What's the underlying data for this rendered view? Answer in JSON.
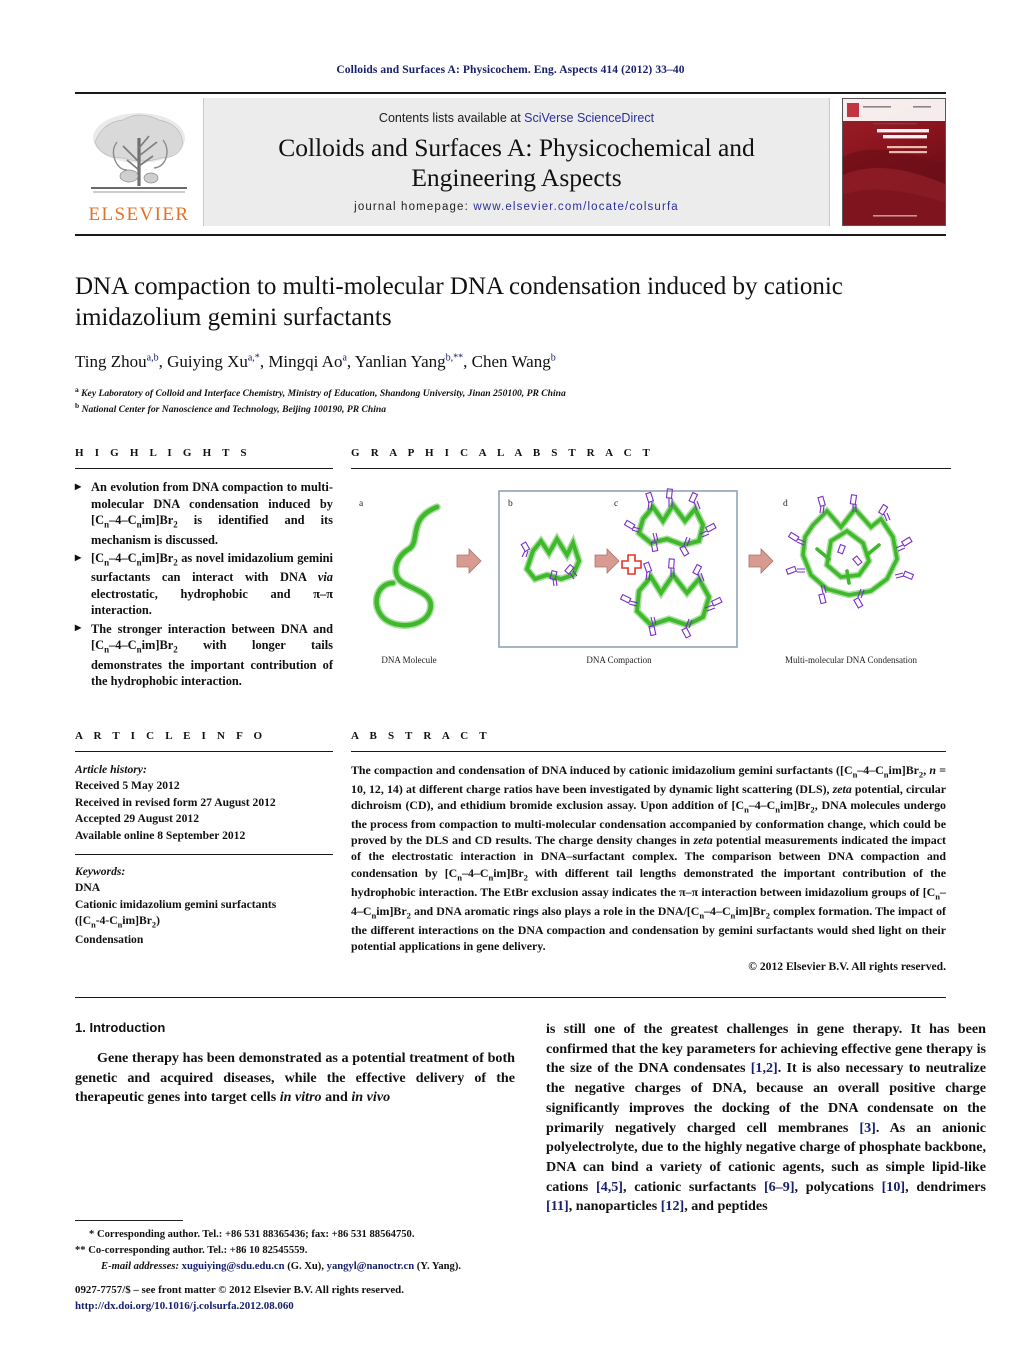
{
  "running_head": "Colloids and Surfaces A: Physicochem. Eng. Aspects 414 (2012) 33–40",
  "masthead": {
    "contents_prefix": "Contents lists available at ",
    "contents_link": "SciVerse ScienceDirect",
    "journal_title_line1": "Colloids and Surfaces A: Physicochemical and",
    "journal_title_line2": "Engineering Aspects",
    "homepage_prefix": "journal homepage:",
    "homepage_url": "www.elsevier.com/locate/colsurfa",
    "publisher": "ELSEVIER",
    "cover_line1": "COLLOIDS AND",
    "cover_line2": "SURFACES A",
    "cover_line3": "Physicochemical and",
    "cover_line4": "Engineering Aspects"
  },
  "article": {
    "title": "DNA compaction to multi-molecular DNA condensation induced by cationic imidazolium gemini surfactants",
    "authors_plain": "Ting Zhou a,b, Guiying Xu a,*, Mingqi Ao a, Yanlian Yang b,**, Chen Wang b",
    "affiliations": [
      {
        "marker": "a",
        "text": "Key Laboratory of Colloid and Interface Chemistry, Ministry of Education, Shandong University, Jinan 250100, PR China"
      },
      {
        "marker": "b",
        "text": "National Center for Nanoscience and Technology, Beijing 100190, PR China"
      }
    ]
  },
  "highlights": {
    "heading": "H I G H L I G H T S",
    "items": [
      "An evolution from DNA compaction to multi-molecular DNA condensation induced by [Cn–4–Cnim]Br2 is identified and its mechanism is discussed.",
      "[Cn–4–Cnim]Br2 as novel imidazolium gemini surfactants can interact with DNA via electrostatic, hydrophobic and π–π interaction.",
      "The stronger interaction between DNA and [Cn–4–Cnim]Br2 with longer tails demonstrates the important contribution of the hydrophobic interaction."
    ]
  },
  "graphical_abstract": {
    "heading": "G R A P H I C A L   A B S T R A C T",
    "panel_letters": [
      "a",
      "b",
      "c",
      "d"
    ],
    "captions": [
      "DNA Molecule",
      "DNA Compaction",
      "Multi-molecular DNA Condensation"
    ],
    "plus_symbol": "+",
    "dna_color": "#3fb82b",
    "surfactant_color": "#7b2ec8",
    "arrow_color": "#d79b91"
  },
  "article_info": {
    "heading": "A R T I C L E   I N F O",
    "history_label": "Article history:",
    "history": [
      "Received 5 May 2012",
      "Received in revised form 27 August 2012",
      "Accepted 29 August 2012",
      "Available online 8 September 2012"
    ],
    "keywords_label": "Keywords:",
    "keywords": [
      "DNA",
      "Cationic imidazolium gemini surfactants",
      "([Cn-4-Cnim]Br2)",
      "Condensation"
    ]
  },
  "abstract": {
    "heading": "A B S T R A C T",
    "text": "The compaction and condensation of DNA induced by cationic imidazolium gemini surfactants ([Cn–4–Cnim]Br2, n = 10, 12, 14) at different charge ratios have been investigated by dynamic light scattering (DLS), zeta potential, circular dichroism (CD), and ethidium bromide exclusion assay. Upon addition of [Cn–4–Cnim]Br2, DNA molecules undergo the process from compaction to multi-molecular condensation accompanied by conformation change, which could be proved by the DLS and CD results. The charge density changes in zeta potential measurements indicated the impact of the electrostatic interaction in DNA–surfactant complex. The comparison between DNA compaction and condensation by [Cn–4–Cnim]Br2 with different tail lengths demonstrated the important contribution of the hydrophobic interaction. The EtBr exclusion assay indicates the π–π interaction between imidazolium groups of [Cn–4–Cnim]Br2 and DNA aromatic rings also plays a role in the DNA/[Cn–4–Cnim]Br2 complex formation. The impact of the different interactions on the DNA compaction and condensation by gemini surfactants would shed light on their potential applications in gene delivery.",
    "copyright": "© 2012 Elsevier B.V. All rights reserved."
  },
  "introduction": {
    "heading": "1.  Introduction",
    "left_paragraph": "Gene therapy has been demonstrated as a potential treatment of both genetic and acquired diseases, while the effective delivery of the therapeutic genes into target cells in vitro and in vivo",
    "right_paragraph": "is still one of the greatest challenges in gene therapy. It has been confirmed that the key parameters for achieving effective gene therapy is the size of the DNA condensates [1,2]. It is also necessary to neutralize the negative charges of DNA, because an overall positive charge significantly improves the docking of the DNA condensate on the primarily negatively charged cell membranes [3]. As an anionic polyelectrolyte, due to the highly negative charge of phosphate backbone, DNA can bind a variety of cationic agents, such as simple lipid-like cations [4,5], cationic surfactants [6–9], polycations [10], dendrimers [11], nanoparticles [12], and peptides"
  },
  "footnotes": {
    "corresponding": "* Corresponding author. Tel.: +86 531 88365436; fax: +86 531 88564750.",
    "co_corresponding": "** Co-corresponding author. Tel.: +86 10 82545559.",
    "email_label": "E-mail addresses:",
    "email1": "xuguiying@sdu.edu.cn",
    "email1_name": "(G. Xu),",
    "email2": "yangyl@nanoctr.cn",
    "email2_name": "(Y. Yang)."
  },
  "footer": {
    "issn_line": "0927-7757/$ – see front matter © 2012 Elsevier B.V. All rights reserved.",
    "doi_line": "http://dx.doi.org/10.1016/j.colsurfa.2012.08.060"
  }
}
